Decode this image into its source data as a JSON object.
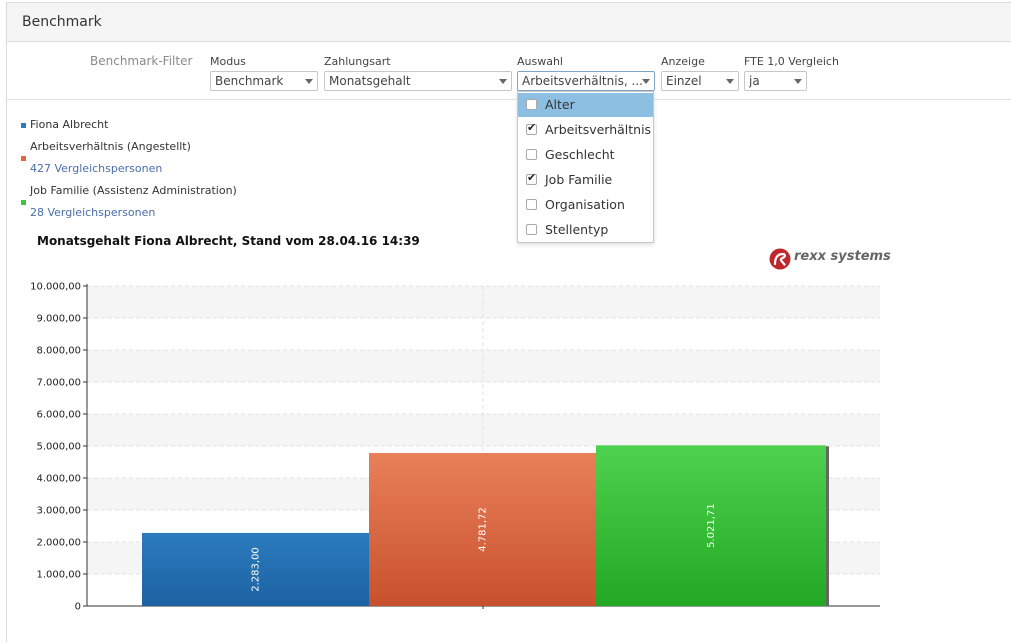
{
  "panel": {
    "title": "Benchmark"
  },
  "filter": {
    "title": "Benchmark-Filter",
    "modus": {
      "label": "Modus",
      "value": "Benchmark"
    },
    "zahlungsart": {
      "label": "Zahlungsart",
      "value": "Monatsgehalt"
    },
    "auswahl": {
      "label": "Auswahl",
      "value": "Arbeitsverhältnis, ..."
    },
    "anzeige": {
      "label": "Anzeige",
      "value": "Einzel"
    },
    "fte": {
      "label": "FTE 1,0 Vergleich",
      "value": "ja"
    }
  },
  "auswahl_options": [
    {
      "label": "Alter",
      "checked": false,
      "highlighted": true
    },
    {
      "label": "Arbeitsverhältnis",
      "checked": true,
      "highlighted": false
    },
    {
      "label": "Geschlecht",
      "checked": false,
      "highlighted": false
    },
    {
      "label": "Job Familie",
      "checked": true,
      "highlighted": false
    },
    {
      "label": "Organisation",
      "checked": false,
      "highlighted": false
    },
    {
      "label": "Stellentyp",
      "checked": false,
      "highlighted": false
    }
  ],
  "legend": [
    {
      "name": "Fiona Albrecht",
      "color": "#2b7bbd",
      "link": ""
    },
    {
      "name": "Arbeitsverhältnis (Angestellt)",
      "color": "#e0693f",
      "link": "427 Vergleichspersonen"
    },
    {
      "name": "Job Familie (Assistenz Administration)",
      "color": "#3fc23f",
      "link": "28 Vergleichspersonen"
    }
  ],
  "brand": {
    "name": "rexx systems",
    "color": "#c0272d"
  },
  "chart_data": {
    "type": "bar",
    "title": "Monatsgehalt Fiona Albrecht, Stand vom 28.04.16 14:39",
    "ylim": [
      0,
      10000
    ],
    "yticks": [
      "0",
      "1.000,00",
      "2.000,00",
      "3.000,00",
      "4.000,00",
      "5.000,00",
      "6.000,00",
      "7.000,00",
      "8.000,00",
      "9.000,00",
      "10.000,00"
    ],
    "series": [
      {
        "name": "Fiona Albrecht",
        "value": 2283.0,
        "label": "2.283,00",
        "color": "#2b7bbd",
        "color_dark": "#1c62a3"
      },
      {
        "name": "Arbeitsverhältnis (Angestellt)",
        "value": 4781.72,
        "label": "4.781,72",
        "color": "#e8805a",
        "color_dark": "#c8512d"
      },
      {
        "name": "Job Familie (Assistenz Administration)",
        "value": 5021.71,
        "label": "5.021,71",
        "color": "#4fd24f",
        "color_dark": "#22a822"
      }
    ],
    "grid": true
  }
}
